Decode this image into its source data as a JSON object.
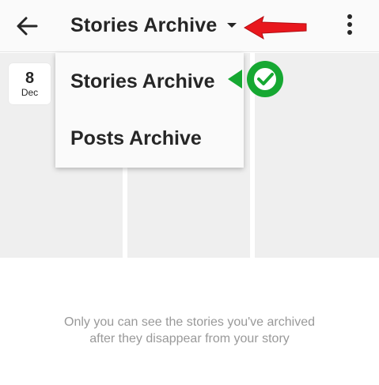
{
  "appbar": {
    "title": "Stories Archive",
    "back_icon": "arrow-left-icon",
    "dropdown_icon": "caret-down-icon",
    "more_icon": "more-vertical-icon"
  },
  "archive": {
    "date_badge": {
      "day": "8",
      "month": "Dec"
    },
    "empty_message": "Only you can see the stories you've archived after they disappear from your story"
  },
  "dropdown": {
    "items": [
      {
        "label": "Stories Archive"
      },
      {
        "label": "Posts Archive"
      }
    ]
  },
  "annotations": {
    "red_arrow": {
      "icon": "pointer-arrow-icon",
      "color": "#e8171d"
    },
    "green_check": {
      "icon": "checkmark-badge-icon",
      "color": "#16a832"
    }
  },
  "colors": {
    "appbar_bg": "#fafafa",
    "tile_bg": "#efefef",
    "text_primary": "#262626",
    "text_secondary": "#999999"
  }
}
